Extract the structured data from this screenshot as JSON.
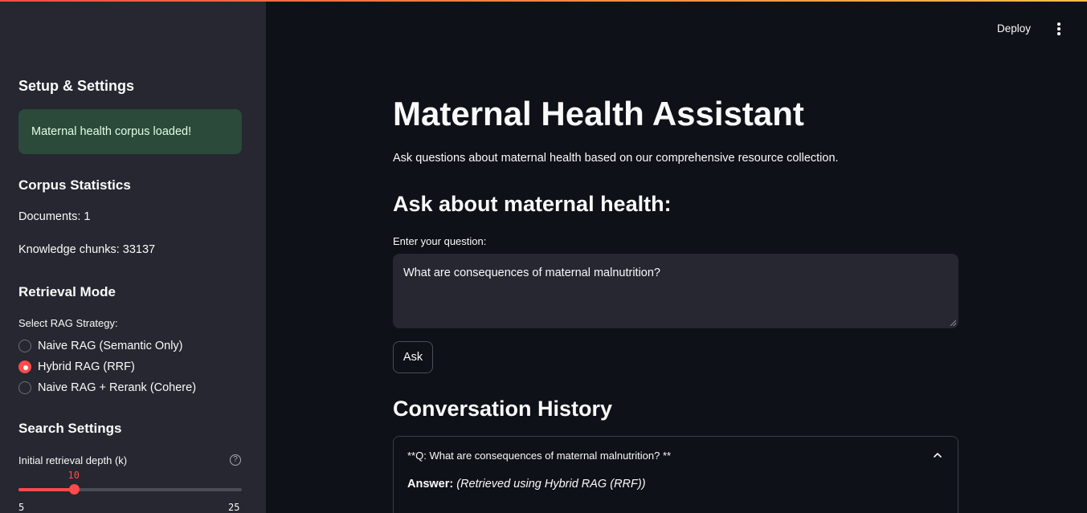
{
  "sidebar": {
    "setup_title": "Setup & Settings",
    "success_message": "Maternal health corpus loaded!",
    "corpus_title": "Corpus Statistics",
    "documents": "Documents: 1",
    "chunks": "Knowledge chunks: 33137",
    "retrieval_title": "Retrieval Mode",
    "strategy_label": "Select RAG Strategy:",
    "strategies": [
      {
        "label": "Naive RAG (Semantic Only)",
        "selected": false
      },
      {
        "label": "Hybrid RAG (RRF)",
        "selected": true
      },
      {
        "label": "Naive RAG + Rerank (Cohere)",
        "selected": false
      }
    ],
    "search_title": "Search Settings",
    "depth_label": "Initial retrieval depth (k)",
    "slider": {
      "value": "10",
      "min": "5",
      "max": "25",
      "fraction": 0.25
    }
  },
  "header": {
    "deploy_label": "Deploy"
  },
  "main": {
    "title": "Maternal Health Assistant",
    "description": "Ask questions about maternal health based on our comprehensive resource collection.",
    "ask_heading": "Ask about maternal health:",
    "input_label": "Enter your question:",
    "question_value": "What are consequences of maternal malnutrition?",
    "ask_button": "Ask",
    "history_heading": "Conversation History",
    "history": [
      {
        "question": "**Q: What are consequences of maternal malnutrition? **",
        "answer_label": "Answer:",
        "answer_meta": "(Retrieved using Hybrid RAG (RRF))"
      }
    ]
  },
  "colors": {
    "accent": "#ff4b4b",
    "background": "#0e1117",
    "sidebar": "#262730",
    "success_bg": "#2b4a3a"
  }
}
